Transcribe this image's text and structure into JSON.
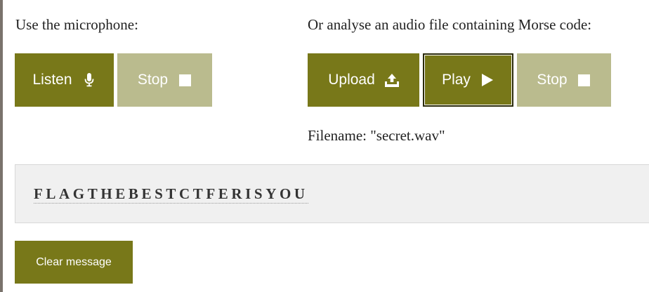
{
  "microphone": {
    "label": "Use the microphone:",
    "listen_label": "Listen",
    "listen_icon": "microphone-icon",
    "stop_label": "Stop",
    "stop_icon": "stop-square-icon"
  },
  "audio_file": {
    "label": "Or analyse an audio file containing Morse code:",
    "upload_label": "Upload",
    "upload_icon": "upload-icon",
    "play_label": "Play",
    "play_icon": "play-triangle-icon",
    "stop_label": "Stop",
    "stop_icon": "stop-square-icon",
    "filename_text": "Filename: \"secret.wav\""
  },
  "result": {
    "decoded_text": "FLAGTHEBESTCTFERISYOU"
  },
  "actions": {
    "clear_label": "Clear message"
  },
  "colors": {
    "button_active": "#787819",
    "button_disabled": "#babb8e",
    "panel_background": "#f0f0f0",
    "left_rule": "#7a736c"
  }
}
